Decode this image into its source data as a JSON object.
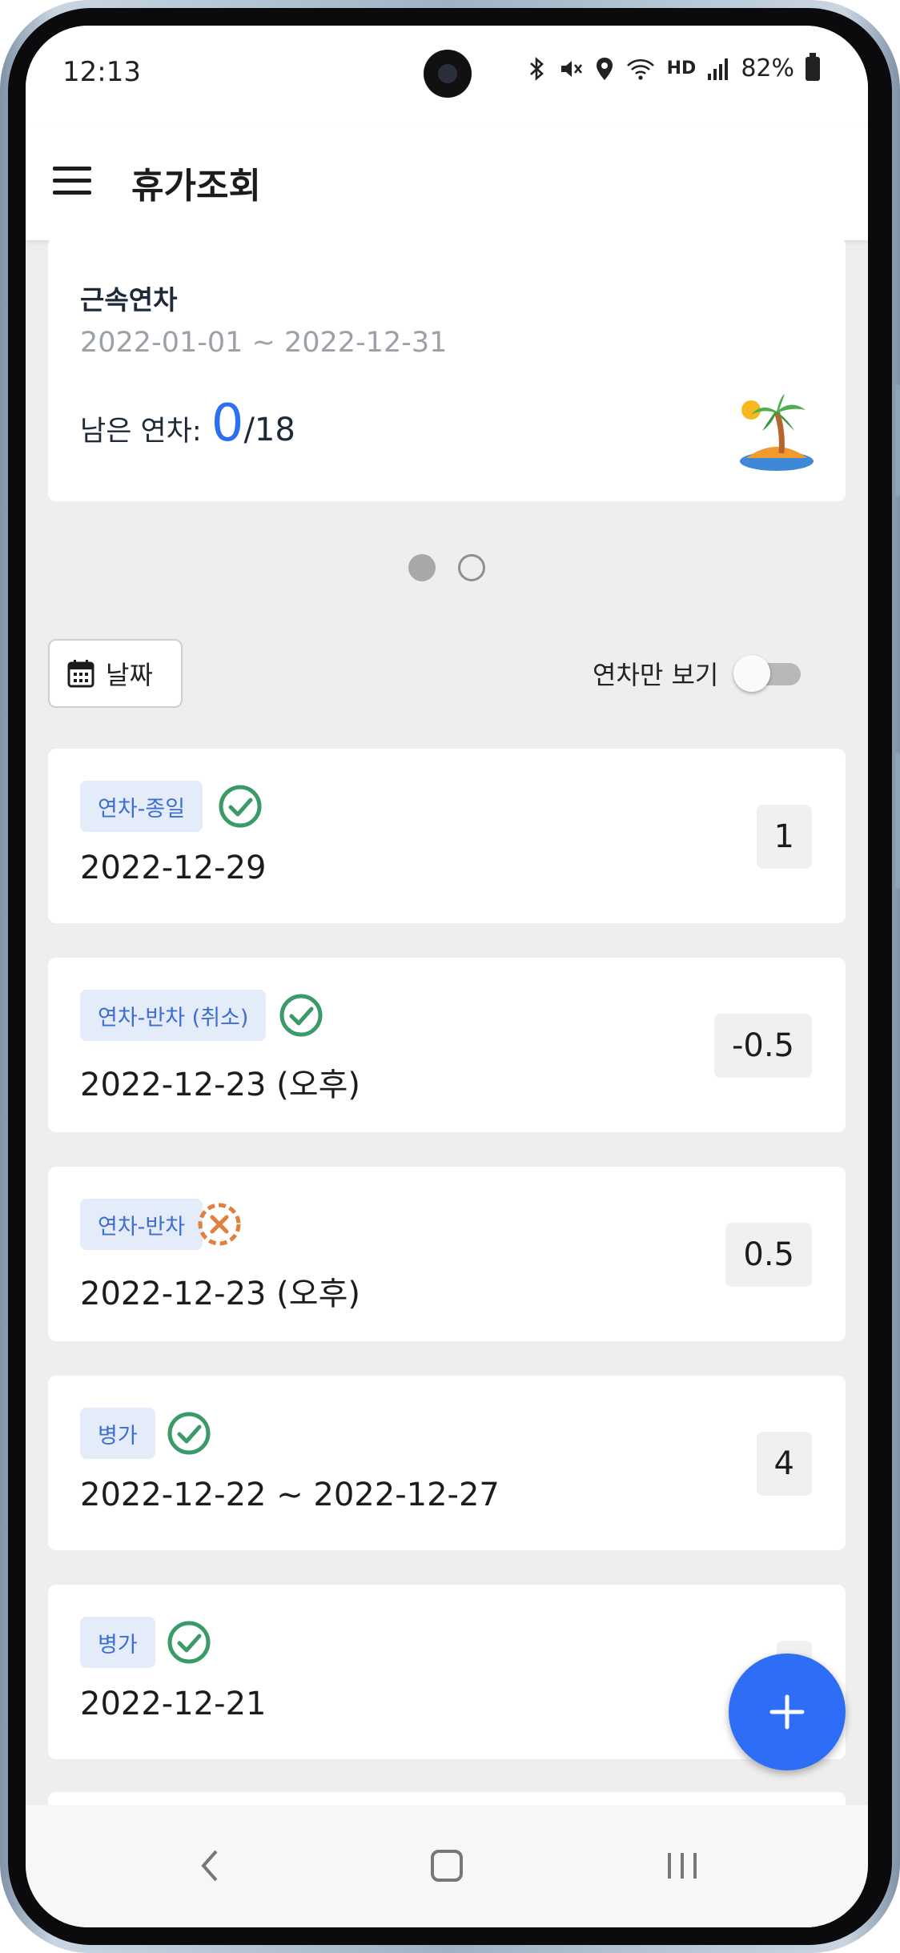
{
  "status_bar": {
    "time": "12:13",
    "network_badge": "HD",
    "battery": "82%"
  },
  "app_bar": {
    "title": "휴가조회"
  },
  "summary_card": {
    "title": "근속연차",
    "period": "2022-01-01 ~ 2022-12-31",
    "remaining_label": "남은 연차:",
    "remaining_value": "0",
    "remaining_total": "/18"
  },
  "pager": {
    "pages": 2,
    "active_index": 0
  },
  "filter": {
    "date_button_label": "날짜",
    "annual_only_label": "연차만 보기",
    "annual_only_enabled": false
  },
  "items": [
    {
      "tag": "연차-종일",
      "status": "approved",
      "date": "2022-12-29",
      "count": "1"
    },
    {
      "tag": "연차-반차 (취소)",
      "status": "approved",
      "date": "2022-12-23 (오후)",
      "count": "-0.5"
    },
    {
      "tag": "연차-반차",
      "status": "cancelled",
      "date": "2022-12-23 (오후)",
      "count": "0.5"
    },
    {
      "tag": "병가",
      "status": "approved",
      "date": "2022-12-22 ~ 2022-12-27",
      "count": "4"
    },
    {
      "tag": "병가",
      "status": "approved",
      "date": "2022-12-21",
      "count": ""
    }
  ],
  "colors": {
    "accent": "#2e6ef6",
    "approved": "#3a9a68",
    "cancelled": "#e0803e",
    "tag_bg": "#e4ebf9",
    "tag_text": "#3d6ed0"
  },
  "icons": {
    "menu": "hamburger-icon",
    "calendar": "calendar-icon",
    "island": "desert-island-icon",
    "fab": "plus-icon",
    "approved": "check-circle-icon",
    "cancelled": "cancel-circle-dashed-icon"
  }
}
